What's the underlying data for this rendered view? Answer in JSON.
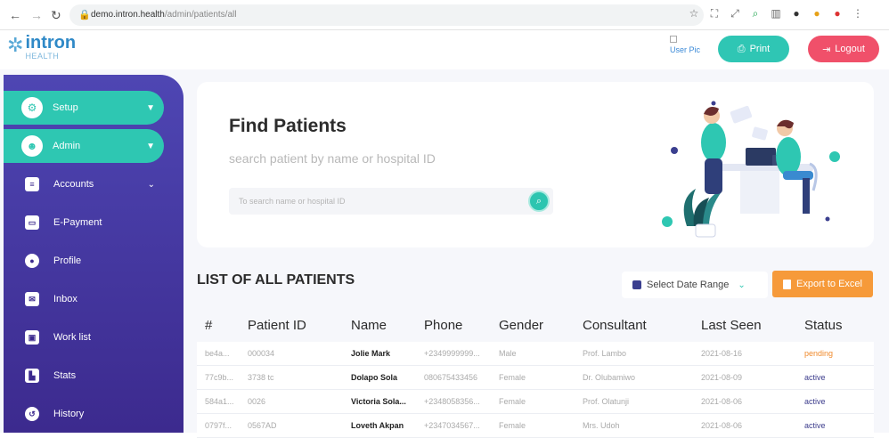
{
  "browser": {
    "url_host": "demo.intron.health",
    "url_path": "/admin/patients/all"
  },
  "logo": {
    "line1": "intron",
    "line2": "HEALTH"
  },
  "header": {
    "user_pic_alt": "User Pic",
    "print_label": "Print",
    "logout_label": "Logout"
  },
  "colors": {
    "teal": "#2ec7b2",
    "sidebar_top": "#4e46b3",
    "sidebar_bottom": "#3c2a8e",
    "logout": "#f0506a",
    "export": "#f69a3a",
    "pending": "#f08a2c"
  },
  "sidebar": {
    "items": [
      {
        "label": "Setup",
        "icon": "gear-icon",
        "active": true,
        "chevron": true
      },
      {
        "label": "Admin",
        "icon": "users-icon",
        "active": true,
        "chevron": true
      },
      {
        "label": "Accounts",
        "icon": "document-icon",
        "active": false,
        "chevron": true
      },
      {
        "label": "E-Payment",
        "icon": "card-icon",
        "active": false,
        "chevron": false
      },
      {
        "label": "Profile",
        "icon": "user-icon",
        "active": false,
        "chevron": false
      },
      {
        "label": "Inbox",
        "icon": "mail-icon",
        "active": false,
        "chevron": false
      },
      {
        "label": "Work list",
        "icon": "briefcase-icon",
        "active": false,
        "chevron": false
      },
      {
        "label": "Stats",
        "icon": "chart-icon",
        "active": false,
        "chevron": false
      },
      {
        "label": "History",
        "icon": "history-icon",
        "active": false,
        "chevron": false
      }
    ]
  },
  "find": {
    "title": "Find Patients",
    "subtitle": "search patient by name or hospital ID",
    "search_placeholder": "To search name or hospital ID"
  },
  "list": {
    "title": "LIST OF ALL PATIENTS",
    "date_range_label": "Select Date Range",
    "export_label": "Export to Excel"
  },
  "table": {
    "headers": [
      "#",
      "Patient ID",
      "Name",
      "Phone",
      "Gender",
      "Consultant",
      "Last Seen",
      "Status"
    ],
    "rows": [
      {
        "id": "be4a...",
        "patient_id": "000034",
        "name": "Jolie Mark",
        "phone": "+2349999999...",
        "gender": "Male",
        "consultant": "Prof. Lambo",
        "last_seen": "2021-08-16",
        "status": "pending"
      },
      {
        "id": "77c9b...",
        "patient_id": "3738 tc",
        "name": "Dolapo Sola",
        "phone": "080675433456",
        "gender": "Female",
        "consultant": "Dr. Olubamiwo",
        "last_seen": "2021-08-09",
        "status": "active"
      },
      {
        "id": "584a1...",
        "patient_id": "0026",
        "name": "Victoria Sola...",
        "phone": "+2348058356...",
        "gender": "Female",
        "consultant": "Prof. Olatunji",
        "last_seen": "2021-08-06",
        "status": "active"
      },
      {
        "id": "0797f...",
        "patient_id": "0567AD",
        "name": "Loveth Akpan",
        "phone": "+2347034567...",
        "gender": "Female",
        "consultant": "Mrs. Udoh",
        "last_seen": "2021-08-06",
        "status": "active"
      }
    ]
  }
}
